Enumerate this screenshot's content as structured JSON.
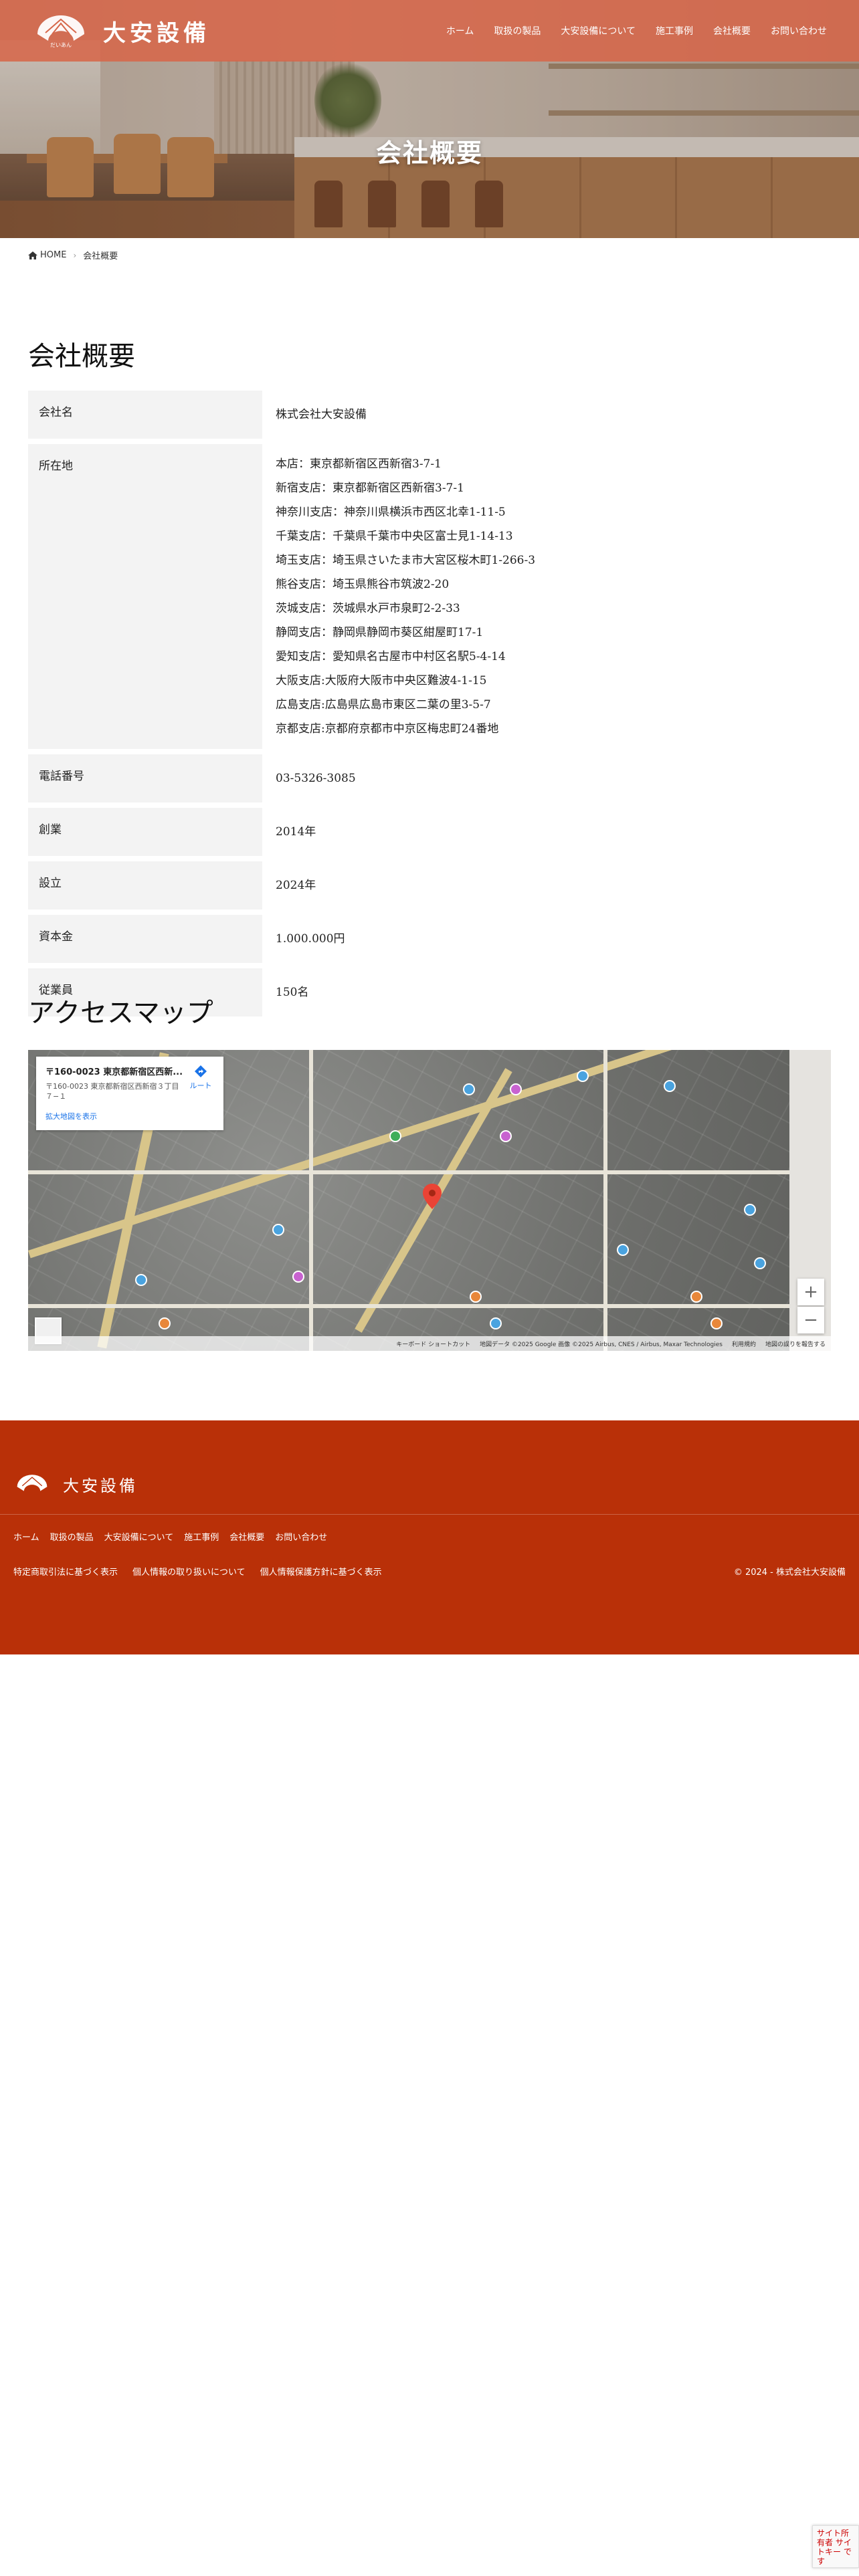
{
  "site": {
    "logo_text": "大安設備",
    "logo_sub": "だいあん"
  },
  "nav": [
    {
      "label": "ホーム"
    },
    {
      "label": "取扱の製品"
    },
    {
      "label": "大安設備について"
    },
    {
      "label": "施工事例"
    },
    {
      "label": "会社概要"
    },
    {
      "label": "お問い合わせ"
    }
  ],
  "hero": {
    "title": "会社概要"
  },
  "breadcrumb": {
    "home": "HOME",
    "current": "会社概要"
  },
  "company": {
    "heading": "会社概要",
    "rows": [
      {
        "label": "会社名",
        "values": [
          "株式会社大安設備"
        ]
      },
      {
        "label": "所在地",
        "values": [
          "本店：東京都新宿区西新宿3-7-1",
          "新宿支店：東京都新宿区西新宿3-7-1",
          "神奈川支店：神奈川県横浜市西区北幸1-11-5",
          "千葉支店：千葉県千葉市中央区富士見1-14-13",
          "埼玉支店：埼玉県さいたま市大宮区桜木町1-266-3",
          "熊谷支店：埼玉県熊谷市筑波2-20",
          "茨城支店：茨城県水戸市泉町2-2-33",
          "静岡支店：静岡県静岡市葵区紺屋町17-1",
          "愛知支店：愛知県名古屋市中村区名駅5-4-14",
          "大阪支店:大阪府大阪市中央区難波4-1-15",
          "広島支店:広島県広島市東区二葉の里3-5-7",
          "京都支店:京都府京都市中京区梅忠町24番地"
        ]
      },
      {
        "label": "電話番号",
        "values": [
          "03-5326-3085"
        ]
      },
      {
        "label": "創業",
        "values": [
          "2014年"
        ]
      },
      {
        "label": "設立",
        "values": [
          "2024年"
        ]
      },
      {
        "label": "資本金",
        "values": [
          "1.000.000円"
        ]
      },
      {
        "label": "従業員",
        "values": [
          "150名"
        ]
      }
    ]
  },
  "access": {
    "heading": "アクセスマップ",
    "map_card": {
      "title": "〒160-0023 東京都新宿区西新...",
      "address": "〒160-0023 東京都新宿区西新宿３丁目７−１",
      "route_label": "ルート",
      "enlarge_label": "拡大地図を表示"
    },
    "zoom_in": "+",
    "zoom_out": "−",
    "footer_items": [
      "キーボード ショートカット",
      "地図データ ©2025 Google 画像 ©2025 Airbus, CNES / Airbus, Maxar Technologies",
      "利用規約",
      "地図の誤りを報告する"
    ]
  },
  "footer": {
    "logo_text": "大安設備",
    "nav": [
      "ホーム",
      "取扱の製品",
      "大安設備について",
      "施工事例",
      "会社概要",
      "お問い合わせ"
    ],
    "links": [
      "特定商取引法に基づく表示",
      "個人情報の取り扱いについて",
      "個人情報保護方針に基づく表示"
    ],
    "copyright": "© 2024 - 株式会社大安設備"
  },
  "recaptcha": {
    "text": "サイト所有者 サイトキー です"
  },
  "colors": {
    "header": "#d6674a",
    "footer": "#b93008"
  }
}
